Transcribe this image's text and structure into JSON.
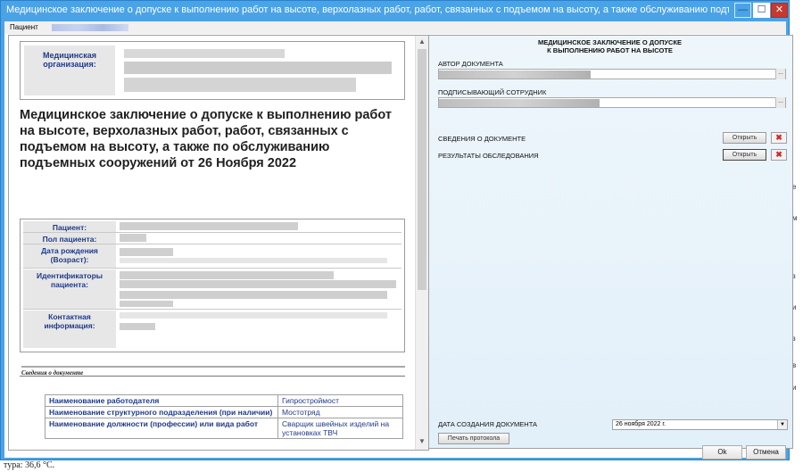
{
  "window": {
    "title": "Медицинское заключение о допуске к выполнению работ на высоте, верхолазных работ, работ, связанных с подъемом на высоту, а также обслуживанию подъемных соо...",
    "minimize_symbol": "—",
    "maximize_symbol": "☐",
    "close_symbol": "✕"
  },
  "menubar": {
    "patient_label": "Пациент"
  },
  "document": {
    "org_label": "Медицинская организация:",
    "title": "Медицинское заключение о допуске к выполнению работ на высоте, верхолазных работ, работ, связанных с подъемом на высоту, а также по обслуживанию подъемных сооружений от 26 Ноября 2022",
    "patient_table": {
      "patient": "Пациент:",
      "sex": "Пол пациента:",
      "birth": "Дата рождения (Возраст):",
      "ids": "Идентификаторы пациента:",
      "contact": "Контактная информация:"
    },
    "section_title": "Сведения о документе",
    "info_rows": [
      {
        "key": "Наименование работодателя",
        "value": "Гипростроймост"
      },
      {
        "key": "Наименование структурного подразделения (при наличии)",
        "value": "Мостотряд"
      },
      {
        "key": "Наименование должности (профессии) или вида работ",
        "value": "Сварщик швейных изделий на установках ТВЧ"
      }
    ]
  },
  "panel": {
    "header_line1": "МЕДИЦИНСКОЕ ЗАКЛЮЧЕНИЕ О ДОПУСКЕ",
    "header_line2": "К ВЫПОЛНЕНИЮ РАБОТ НА ВЫСОТЕ",
    "author_label": "АВТОР ДОКУМЕНТА",
    "signer_label": "ПОДПИСЫВАЮЩИЙ СОТРУДНИК",
    "dots_label": "...",
    "doc_info_label": "СВЕДЕНИЯ О ДОКУМЕНТЕ",
    "results_label": "РЕЗУЛЬТАТЫ ОБСЛЕДОВАНИЯ",
    "open_label": "Открыть",
    "delete_symbol": "✖",
    "date_label": "ДАТА СОЗДАНИЯ ДОКУМЕНТА",
    "date_value": "26  ноября  2022 г.",
    "print_label": "Печать протокола"
  },
  "footer": {
    "ok_label": "Ok",
    "cancel_label": "Отмена"
  },
  "background": {
    "bottom_text": "тура: 36,6 °C."
  }
}
